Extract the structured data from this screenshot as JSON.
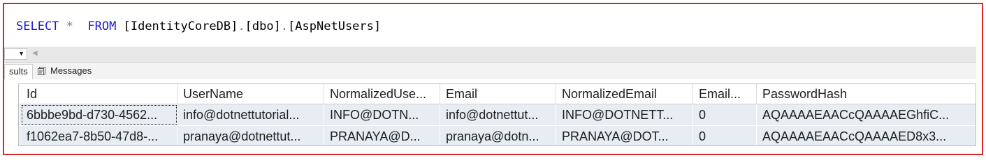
{
  "query": {
    "keyword_select": "SELECT",
    "star": "*",
    "keyword_from": "FROM",
    "db": "[IdentityCoreDB]",
    "schema": "[dbo]",
    "table": "[AspNetUsers]",
    "dot": "."
  },
  "tabs": {
    "results_label": "sults",
    "messages_label": "Messages"
  },
  "grid": {
    "columns": [
      "Id",
      "UserName",
      "NormalizedUse...",
      "Email",
      "NormalizedEmail",
      "Email...",
      "PasswordHash"
    ],
    "rows": [
      [
        "6bbbe9bd-d730-4562...",
        "info@dotnettutorial...",
        "INFO@DOTN...",
        "info@dotnettut...",
        "INFO@DOTNETT...",
        "0",
        "AQAAAAEAACcQAAAAEGhfiC..."
      ],
      [
        "f1062ea7-8b50-47d8-...",
        "pranaya@dotnettut...",
        "PRANAYA@D...",
        "pranaya@dotn...",
        "PRANAYA@DOT...",
        "0",
        "AQAAAAEAACcQAAAAED8x3..."
      ]
    ]
  },
  "colors": {
    "frame_border": "#d7262c",
    "keyword": "#1c1cd0",
    "row_background": "#e7edf3"
  },
  "icons": [
    "dropdown-arrow-icon",
    "scroll-left-icon",
    "messages-icon"
  ]
}
